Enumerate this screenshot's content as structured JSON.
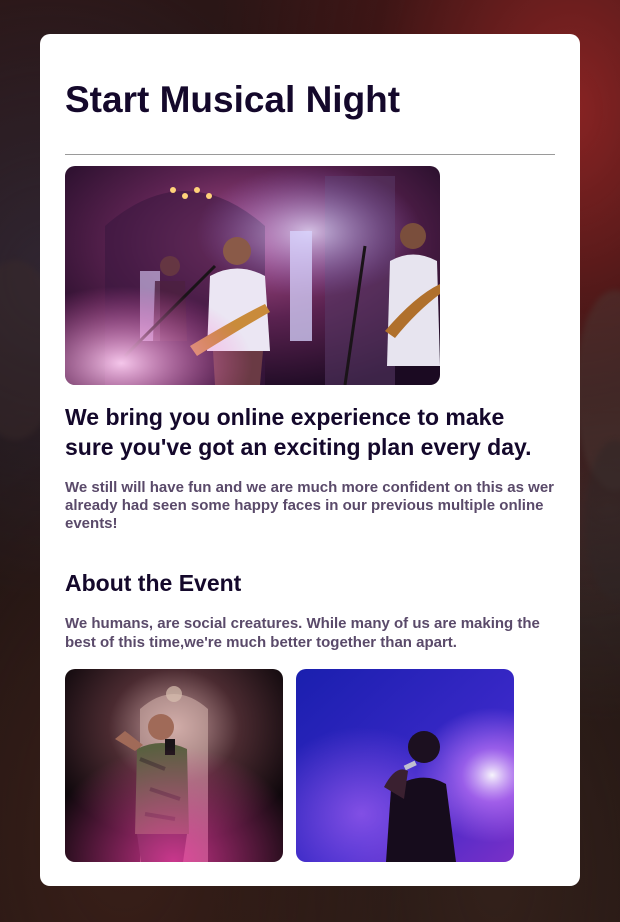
{
  "header": {
    "title": "Start Musical Night"
  },
  "hero": {
    "image": "band-on-stage-photo"
  },
  "intro": {
    "headline": "We bring you online experience to make sure you've got an exciting plan every day.",
    "text": "We still will have fun and we are much more confident on this as wer already had seen some happy faces in our previous multiple online events!"
  },
  "about": {
    "title": "About the Event",
    "text": "We humans, are social creatures. While many of us are making the best of this time,we're much better together than apart."
  },
  "gallery": {
    "images": [
      "rapper-performing-photo",
      "singer-with-microphone-photo"
    ]
  },
  "colors": {
    "heading": "#14082b",
    "body_text": "#5a4a6a",
    "card_bg": "#ffffff",
    "divider": "#9a9a9a"
  }
}
